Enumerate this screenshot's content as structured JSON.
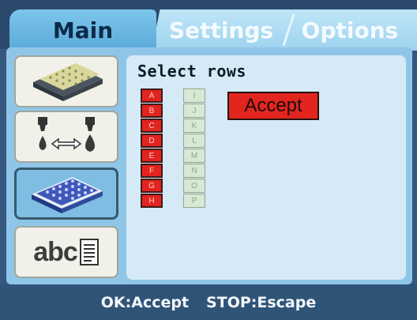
{
  "tabs": [
    {
      "label": "Main",
      "active": true
    },
    {
      "label": "Settings",
      "active": false
    },
    {
      "label": "Options",
      "active": false
    }
  ],
  "sidebar": {
    "items": [
      {
        "name": "plates-icon"
      },
      {
        "name": "dispense-transfer-icon"
      },
      {
        "name": "plate-select-icon",
        "selected": true
      },
      {
        "name": "text-label-icon",
        "text": "abc"
      }
    ]
  },
  "main": {
    "title": "Select rows",
    "rows_left": [
      "A",
      "B",
      "C",
      "D",
      "E",
      "F",
      "G",
      "H"
    ],
    "rows_right": [
      "I",
      "J",
      "K",
      "L",
      "M",
      "N",
      "O",
      "P"
    ],
    "accept_label": "Accept"
  },
  "footer": {
    "ok": "OK:Accept",
    "stop": "STOP:Escape"
  },
  "colors": {
    "accent_red": "#e2231f",
    "tab_active": "#6fb9e6",
    "panel": "#8fc6e8"
  }
}
